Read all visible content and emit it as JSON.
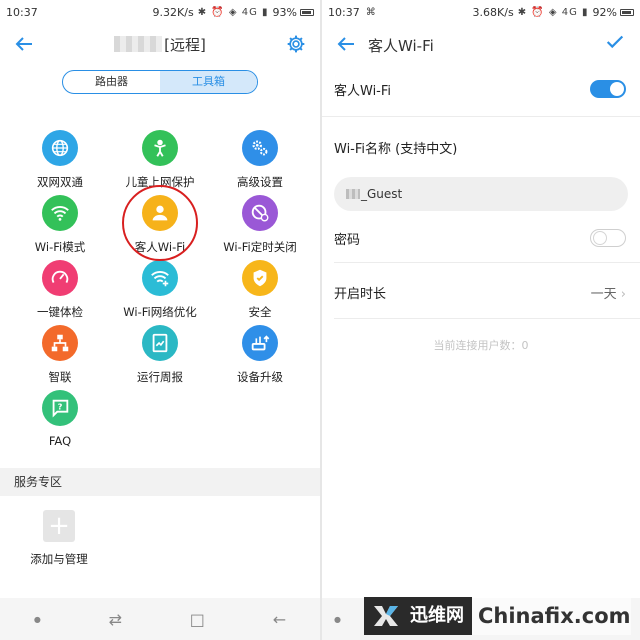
{
  "left": {
    "status": {
      "time": "10:37",
      "speed": "9.32K/s",
      "battery": "93%"
    },
    "header": {
      "title_suffix": "[远程]"
    },
    "segments": [
      {
        "label": "路由器",
        "active": false
      },
      {
        "label": "工具箱",
        "active": true
      }
    ],
    "tools": [
      {
        "label": "双网双通",
        "icon": "globe-icon",
        "color": "#2ea6e6"
      },
      {
        "label": "儿童上网保护",
        "icon": "child-icon",
        "color": "#33c159"
      },
      {
        "label": "高级设置",
        "icon": "gears-icon",
        "color": "#2f8fe8"
      },
      {
        "label": "Wi-Fi模式",
        "icon": "wifi-icon",
        "color": "#33c159"
      },
      {
        "label": "客人Wi-Fi",
        "icon": "guest-user-icon",
        "color": "#f6b21a"
      },
      {
        "label": "Wi-Fi定时关闭",
        "icon": "wifi-timer-icon",
        "color": "#9a58d6"
      },
      {
        "label": "一键体检",
        "icon": "checkup-gauge-icon",
        "color": "#f03d73"
      },
      {
        "label": "Wi-Fi网络优化",
        "icon": "wifi-optimize-icon",
        "color": "#2bbcd6"
      },
      {
        "label": "安全",
        "icon": "shield-icon",
        "color": "#f7b61a"
      },
      {
        "label": "智联",
        "icon": "network-tree-icon",
        "color": "#f36a2b"
      },
      {
        "label": "运行周报",
        "icon": "report-icon",
        "color": "#2bb8c4"
      },
      {
        "label": "设备升级",
        "icon": "router-upgrade-icon",
        "color": "#2f8fe8"
      },
      {
        "label": "FAQ",
        "icon": "faq-chat-icon",
        "color": "#33c17a"
      }
    ],
    "section_title": "服务专区",
    "add_label": "添加与管理"
  },
  "right": {
    "status": {
      "time": "10:37",
      "speed": "3.68K/s",
      "battery": "92%"
    },
    "header": {
      "title": "客人Wi-Fi"
    },
    "guest_wifi_label": "客人Wi-Fi",
    "guest_wifi_enabled": true,
    "ssid_label": "Wi-Fi名称 (支持中文)",
    "ssid_value": "_Guest",
    "password_label": "密码",
    "password_enabled": false,
    "duration_label": "开启时长",
    "duration_value": "一天",
    "connected_text": "当前连接用户数：0"
  },
  "watermark": {
    "brand_cn": "迅维网",
    "brand_en": "Chinafix.com"
  }
}
